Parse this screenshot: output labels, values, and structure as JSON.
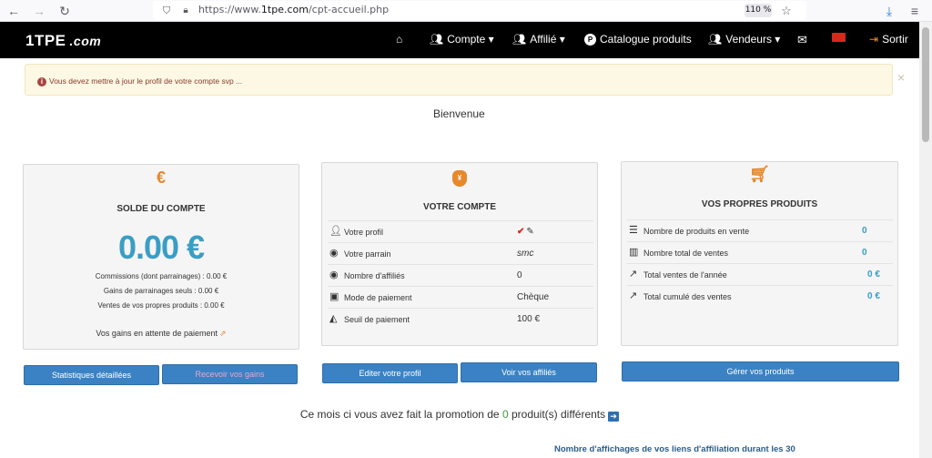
{
  "browser": {
    "url_prefix": "https://www.",
    "url_host": "1tpe.com",
    "url_path": "/cpt-accueil.php",
    "zoom": "110 %"
  },
  "nav": {
    "logo_main": "1TPE",
    "logo_suffix": ".com",
    "items": [
      {
        "label": "Compte"
      },
      {
        "label": "Affilié"
      },
      {
        "label": "Catalogue produits"
      },
      {
        "label": "Vendeurs"
      },
      {
        "label": "Sortir"
      }
    ]
  },
  "alert": {
    "text": "Vous devez mettre à jour le profil de votre compte svp ...",
    "close": "×"
  },
  "welcome": "Bienvenue",
  "balance_panel": {
    "icon": "€",
    "title": "SOLDE DU COMPTE",
    "amount": "0.00 €",
    "lines": [
      "Commissions (dont parrainages) : 0.00 €",
      "Gains de parrainages seuls : 0.00 €",
      "Ventes de vos propres produits : 0.00 €"
    ],
    "pending": "Vos gains en attente de paiement"
  },
  "account_panel": {
    "title": "VOTRE COMPTE",
    "rows": [
      {
        "label": "Votre profil",
        "value": ""
      },
      {
        "label": "Votre parrain",
        "value": "smc"
      },
      {
        "label": "Nombre d'affiliés",
        "value": "0"
      },
      {
        "label": "Mode de paiement",
        "value": "Chèque"
      },
      {
        "label": "Seuil de paiement",
        "value": "100 €"
      }
    ]
  },
  "products_panel": {
    "title": "VOS PROPRES PRODUITS",
    "rows": [
      {
        "label": "Nombre de produits en vente",
        "value": "0"
      },
      {
        "label": "Nombre total de ventes",
        "value": "0"
      },
      {
        "label": "Total ventes de l'année",
        "value": "0 €"
      },
      {
        "label": "Total cumulé des ventes",
        "value": "0 €"
      }
    ]
  },
  "buttons": {
    "stats": "Statistiques détaillées",
    "receive": "Recevoir vos gains",
    "edit_profile": "Editer votre profil",
    "see_affiliates": "Voir vos affiliés",
    "manage_products": "Gérer vos produits"
  },
  "promo": {
    "before": "Ce mois ci vous avez fait la promotion de ",
    "count": "0",
    "after": " produit(s) différents"
  },
  "bottom_note": "Nombre d'affichages de vos liens d'affiliation durant les 30",
  "colors": {
    "accent": "#3a9ec4",
    "button": "#3a82c4",
    "icon": "#e6882b"
  }
}
